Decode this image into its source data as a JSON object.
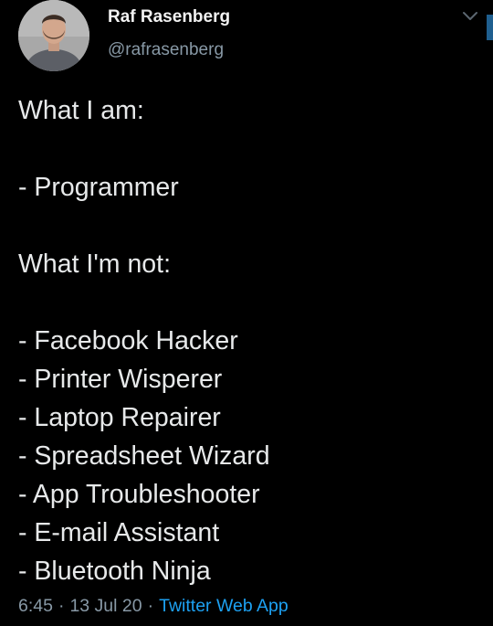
{
  "author": {
    "display_name": "Raf Rasenberg",
    "handle": "@rafrasenberg",
    "avatar_icon": "profile-photo"
  },
  "tweet": {
    "lines": [
      "What I am:",
      "",
      "- Programmer",
      "",
      "What I'm not:",
      "",
      "- Facebook Hacker",
      "- Printer Wisperer",
      "- Laptop Repairer",
      "- Spreadsheet Wizard",
      "- App Troubleshooter",
      "- E-mail Assistant",
      "- Bluetooth Ninja"
    ]
  },
  "meta": {
    "time": "6:45",
    "separator": "·",
    "date": "13 Jul 20",
    "source": "Twitter Web App"
  },
  "colors": {
    "background": "#000000",
    "text": "#e7e9ea",
    "secondary": "#8899a6",
    "link": "#1da1f2"
  },
  "icons": {
    "menu": "chevron-down-icon"
  }
}
